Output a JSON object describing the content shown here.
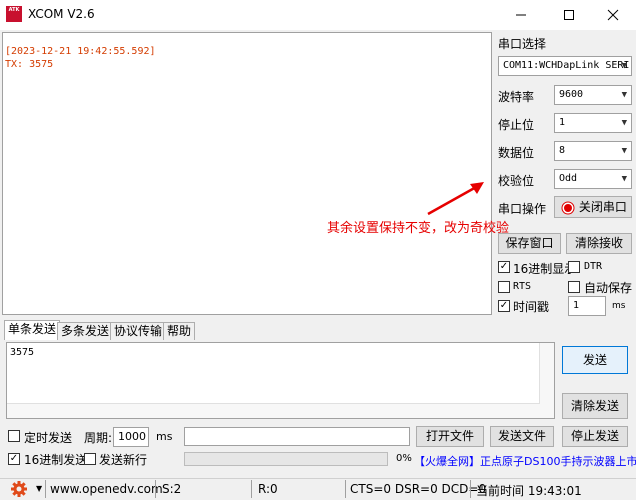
{
  "window": {
    "title": "XCOM V2.6",
    "logo_text": "ATK"
  },
  "receive": {
    "lines": [
      "[2023-12-21 19:42:55.592]",
      "TX: 3575"
    ]
  },
  "serial": {
    "port_label": "串口选择",
    "port_value": "COM11:WCHDapLink SERI",
    "baud_label": "波特率",
    "baud_value": "9600",
    "stop_label": "停止位",
    "stop_value": "1",
    "data_label": "数据位",
    "data_value": "8",
    "parity_label": "校验位",
    "parity_value": "Odd",
    "op_label": "串口操作",
    "op_button": "关闭串口"
  },
  "annotation": "其余设置保持不变，改为奇校验",
  "actions": {
    "save_window": "保存窗口",
    "clear_receive": "清除接收"
  },
  "options": {
    "hex_display": "16进制显示",
    "dtr": "DTR",
    "rts": "RTS",
    "auto_save": "自动保存",
    "timestamp": "时间戳",
    "timestamp_value": "1",
    "timestamp_unit": "ms"
  },
  "tabs": [
    "单条发送",
    "多条发送",
    "协议传输",
    "帮助"
  ],
  "send": {
    "content": "3575",
    "send_button": "发送",
    "clear_send_button": "清除发送"
  },
  "bottom": {
    "timed_send": "定时发送",
    "period_label": "周期:",
    "period_value": "1000",
    "period_unit": "ms",
    "open_file": "打开文件",
    "send_file": "发送文件",
    "stop_send": "停止发送",
    "hex_send": "16进制发送",
    "send_newline": "发送新行",
    "progress": "0%",
    "ad_link": "【火爆全网】正点原子DS100手持示波器上市"
  },
  "status": {
    "url": "www.openedv.com",
    "sent": "S:2",
    "received": "R:0",
    "signals": "CTS=0 DSR=0 DCD=0",
    "time": "当前时间 19:43:01"
  },
  "colors": {
    "receive_text": "#d43c00",
    "annotation": "#e60000",
    "ad_text": "#0000ff",
    "gear": "#e04a1a"
  }
}
